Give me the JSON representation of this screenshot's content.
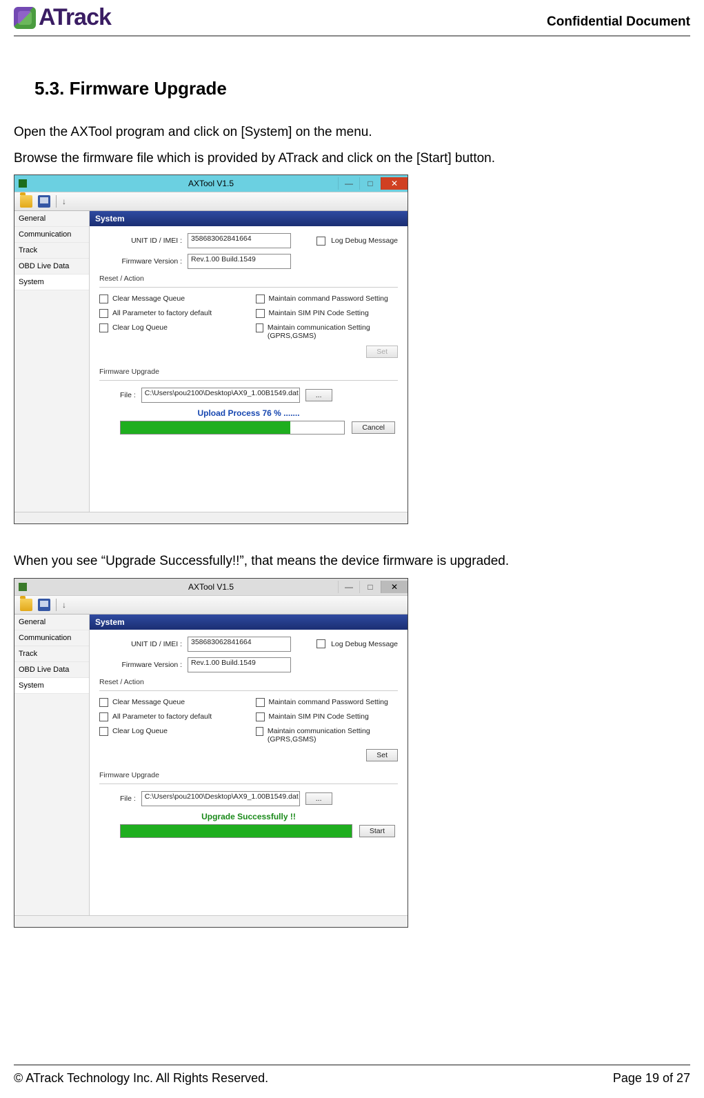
{
  "header": {
    "logo_text": "ATrack",
    "confidential": "Confidential  Document"
  },
  "section": {
    "title": "5.3.  Firmware  Upgrade"
  },
  "para1": "Open the AXTool program and click on [System] on the menu.",
  "para2": "Browse the firmware file which is provided by ATrack and click on the [Start] button.",
  "para3": "When you see “Upgrade Successfully!!”, that means the device firmware is upgraded.",
  "app": {
    "title": "AXTool V1.5",
    "sidebar": [
      "General",
      "Communication",
      "Track",
      "OBD Live Data",
      "System"
    ],
    "panel_title": "System",
    "unit_label": "UNIT ID / IMEI :",
    "unit_value": "358683062841664",
    "log_debug": "Log Debug Message",
    "fw_label": "Firmware Version :",
    "fw_value": "Rev.1.00 Build.1549",
    "reset_group": "Reset / Action",
    "cb": {
      "clear_msg": "Clear Message Queue",
      "maintain_pw": "Maintain command Password Setting",
      "all_param": "All Parameter to factory default",
      "maintain_sim": "Maintain SIM PIN Code Setting",
      "clear_log": "Clear Log Queue",
      "maintain_comm": "Maintain communication Setting (GPRS,GSMS)"
    },
    "set_btn": "Set",
    "fwup_group": "Firmware Upgrade",
    "file_label": "File :",
    "file_value": "C:\\Users\\pou2100\\Desktop\\AX9_1.00B1549.dat",
    "browse_btn": "...",
    "shot1": {
      "status": "Upload Process 76 % .......",
      "progress_pct": 76,
      "action_btn": "Cancel"
    },
    "shot2": {
      "status": "Upgrade Successfully !!",
      "action_btn": "Start"
    }
  },
  "footer": {
    "copyright": "© ATrack Technology Inc. All Rights Reserved.",
    "page": "Page 19 of 27"
  }
}
